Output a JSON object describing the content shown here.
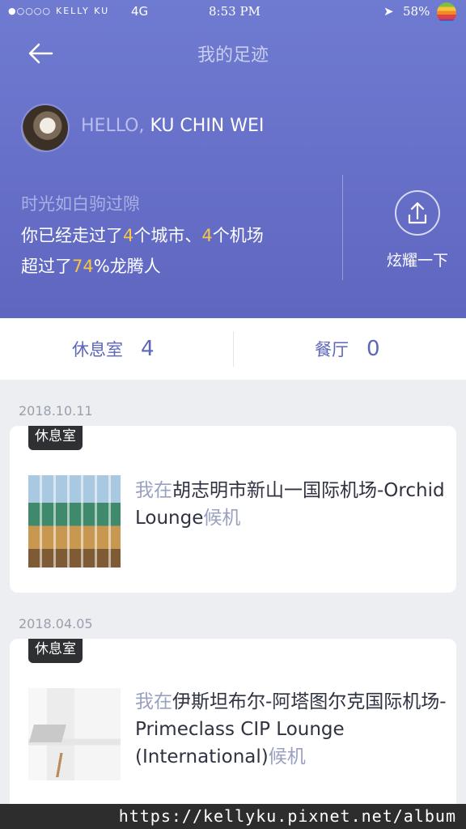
{
  "status_bar": {
    "dots": "●○○○○",
    "carrier": "KELLY KU",
    "network": "4G",
    "time": "8:53 PM",
    "battery": "58%"
  },
  "header": {
    "title": "我的足迹",
    "hello_prefix": "HELLO,",
    "user_name": "KU CHIN WEI"
  },
  "summary": {
    "slogan": "时光如白驹过隙",
    "line1_a": "你已经走过了",
    "cities": "4",
    "line1_b": "个城市、",
    "airports": "4",
    "line1_c": "个机场",
    "line2_a": "超过了",
    "percent": "74",
    "line2_b": "%龙腾人"
  },
  "share": {
    "label": "炫耀一下"
  },
  "stats": {
    "lounge_label": "休息室",
    "lounge_count": "4",
    "restaurant_label": "餐厅",
    "restaurant_count": "0"
  },
  "entries": [
    {
      "date": "2018.10.11",
      "tag": "休息室",
      "prefix": "我在",
      "place": "胡志明市新山一国际机场-Orchid Lounge",
      "suffix": "候机"
    },
    {
      "date": "2018.04.05",
      "tag": "休息室",
      "prefix": "我在",
      "place": "伊斯坦布尔-阿塔图尔克国际机场-Primeclass CIP Lounge (International)",
      "suffix": "候机"
    }
  ],
  "watermark": "https://kellyku.pixnet.net/album"
}
